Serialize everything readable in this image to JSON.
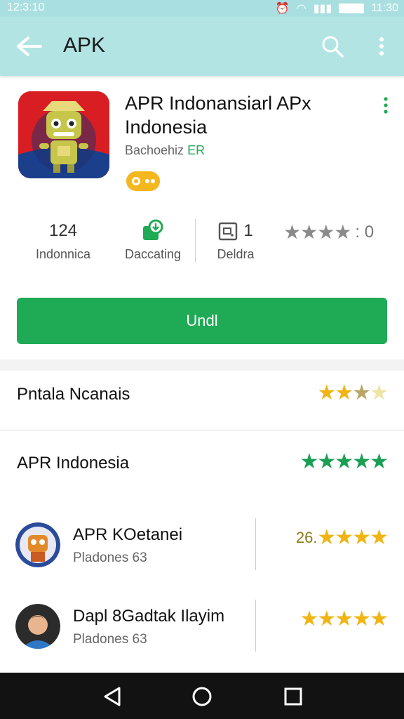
{
  "status_bar": {
    "time": "12:3:10",
    "clock": "11:30"
  },
  "app_bar": {
    "title": "APK"
  },
  "app": {
    "title": "APR Indonansiarl APx Indonesia",
    "developer": "Bachoehiz",
    "developer_badge": "ER"
  },
  "stats": [
    {
      "value": "124",
      "label": "Indonnica"
    },
    {
      "value": "",
      "label": "Daccating"
    },
    {
      "value": "1",
      "label": "Deldra"
    }
  ],
  "rating_stat": {
    "stars": "★★★★",
    "value": ": 0"
  },
  "install_button": {
    "label": "Undl"
  },
  "sections": [
    {
      "title": "Pntala Ncanais",
      "stars": "★★★★★"
    },
    {
      "title": "APR Indonesia",
      "stars": "★★★★★"
    }
  ],
  "related": [
    {
      "name": "APR KOetanei",
      "sub": "Pladones 63",
      "rating": "26.",
      "stars": "★★★★"
    },
    {
      "name": "Dapl 8Gadtak Ilayim",
      "sub": "Pladones 63",
      "rating": "",
      "stars": "★★★★★"
    }
  ],
  "colors": {
    "accent": "#1faa55",
    "app_bar": "#b2e4e4",
    "star_gold": "#f0b515",
    "star_green": "#1a9f55"
  },
  "icons": [
    "back-arrow-icon",
    "search-icon",
    "more-vert-icon",
    "app-icon",
    "download-icon",
    "calendar-icon",
    "star-icon",
    "nav-back-icon",
    "nav-home-icon",
    "nav-recents-icon"
  ]
}
